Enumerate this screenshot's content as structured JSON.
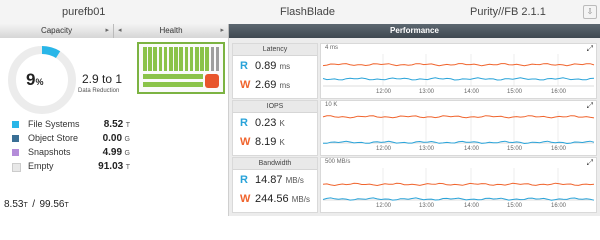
{
  "header": {
    "array_name": "purefb01",
    "product": "FlashBlade",
    "version": "Purity//FB 2.1.1"
  },
  "tabs": {
    "capacity": "Capacity",
    "health": "Health",
    "performance": "Performance"
  },
  "capacity": {
    "percent": "9",
    "percent_sign": "%",
    "used_fraction": 0.09,
    "reduction_ratio": "2.9 to 1",
    "reduction_label": "Data Reduction",
    "legend": [
      {
        "label": "File Systems",
        "value": "8.52",
        "unit": "T",
        "color": "#29b6e8"
      },
      {
        "label": "Object Store",
        "value": "0.00",
        "unit": "G",
        "color": "#3a6f95"
      },
      {
        "label": "Snapshots",
        "value": "4.99",
        "unit": "G",
        "color": "#b48cd9"
      },
      {
        "label": "Empty",
        "value": "91.03",
        "unit": "T",
        "color": "#e8e8e8"
      }
    ],
    "total_used": "8.53",
    "total_used_unit": "T",
    "separator": "/",
    "total": "99.56",
    "total_unit": "T"
  },
  "health": {
    "accent": "#e8552c",
    "ok_color": "#8bc34a"
  },
  "performance": {
    "colors": {
      "read": "#29a3d9",
      "write": "#f0642d"
    },
    "time_labels": [
      "12:00",
      "13:00",
      "14:00",
      "15:00",
      "16:00"
    ],
    "latency": {
      "title": "Latency",
      "r_label": "R",
      "w_label": "W",
      "read_value": "0.89",
      "read_unit": "ms",
      "write_value": "2.69",
      "write_unit": "ms",
      "scale": "4 ms",
      "read_level": 0.22,
      "write_level": 0.67
    },
    "iops": {
      "title": "IOPS",
      "r_label": "R",
      "w_label": "W",
      "read_value": "0.23",
      "read_unit": "K",
      "write_value": "8.19",
      "write_unit": "K",
      "scale": "10 K",
      "read_level": 0.02,
      "write_level": 0.82
    },
    "bandwidth": {
      "title": "Bandwidth",
      "r_label": "R",
      "w_label": "W",
      "read_value": "14.87",
      "read_unit": "MB/s",
      "write_value": "244.56",
      "write_unit": "MB/s",
      "scale": "500 MB/s",
      "read_level": 0.03,
      "write_level": 0.49
    }
  }
}
